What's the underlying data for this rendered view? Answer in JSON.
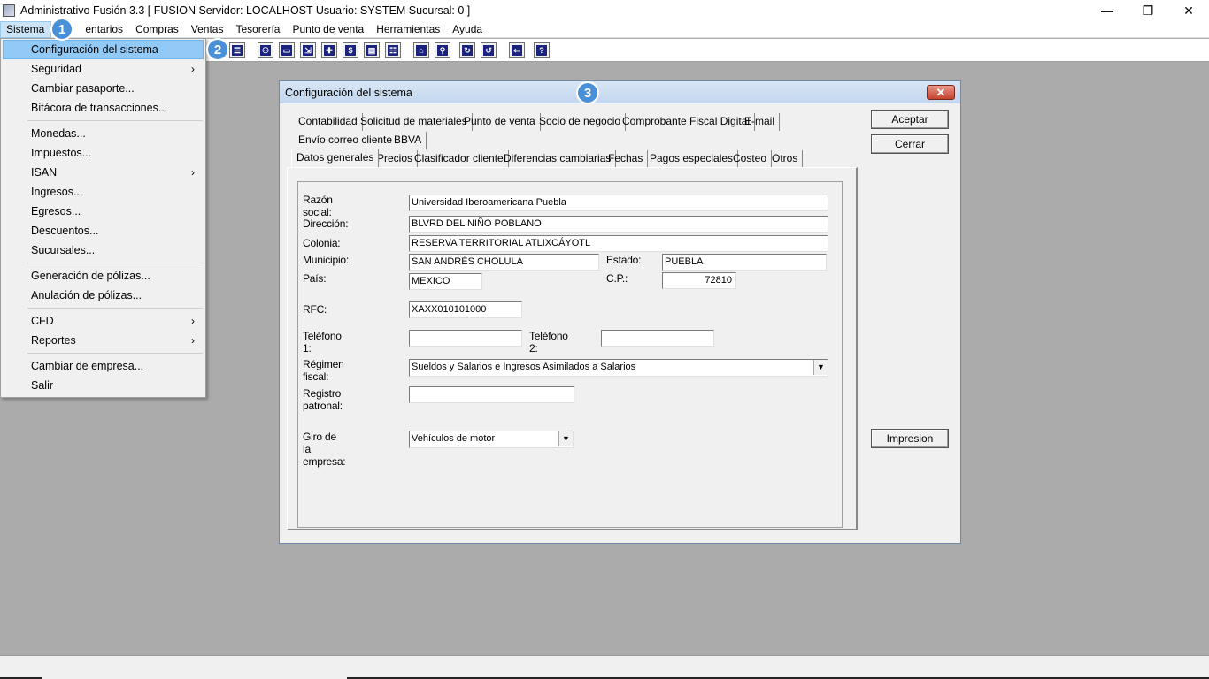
{
  "window": {
    "title": "Administrativo Fusión 3.3 [ FUSION   Servidor: LOCALHOST   Usuario: SYSTEM    Sucursal: 0 ]",
    "minimize": "—",
    "restore": "❐",
    "close": "✕"
  },
  "menubar": {
    "items": [
      "Sistema",
      "Inventarios",
      "Compras",
      "Ventas",
      "Tesorería",
      "Punto de venta",
      "Herramientas",
      "Ayuda"
    ],
    "visible_labels": [
      "Sistema",
      "entarios",
      "Compras",
      "Ventas",
      "Tesorería",
      "Punto de venta",
      "Herramientas",
      "Ayuda"
    ]
  },
  "badges": [
    "1",
    "2",
    "3"
  ],
  "toolbar": {
    "icons": [
      "config-icon",
      "binoculars-icon",
      "folder-icon",
      "export-icon",
      "add-icon",
      "dollar-icon",
      "document-icon",
      "list-icon",
      "home-icon",
      "zoom-icon",
      "refresh-icon",
      "undo-icon",
      "back-arrow-icon",
      "help-icon"
    ],
    "glyphs": [
      "☰",
      "⚇",
      "▭",
      "⇲",
      "✚",
      "$",
      "▤",
      "☷",
      "⌂",
      "⚲",
      "↻",
      "↺",
      "⇐",
      "?"
    ]
  },
  "sistema_menu": {
    "items": [
      {
        "label": "Configuración del sistema",
        "submenu": false
      },
      {
        "label": "Seguridad",
        "submenu": true
      },
      {
        "label": "Cambiar pasaporte...",
        "submenu": false
      },
      {
        "label": "Bitácora de transacciones...",
        "submenu": false
      },
      {
        "label": "Monedas...",
        "submenu": false
      },
      {
        "label": "Impuestos...",
        "submenu": false
      },
      {
        "label": "ISAN",
        "submenu": true
      },
      {
        "label": "Ingresos...",
        "submenu": false
      },
      {
        "label": "Egresos...",
        "submenu": false
      },
      {
        "label": "Descuentos...",
        "submenu": false
      },
      {
        "label": "Sucursales...",
        "submenu": false
      },
      {
        "label": "Generación de pólizas...",
        "submenu": false
      },
      {
        "label": "Anulación de pólizas...",
        "submenu": false
      },
      {
        "label": "CFD",
        "submenu": true
      },
      {
        "label": "Reportes",
        "submenu": true
      },
      {
        "label": "Cambiar de empresa...",
        "submenu": false
      },
      {
        "label": "Salir",
        "submenu": false
      }
    ],
    "arrow": "›"
  },
  "dialog": {
    "title": "Configuración del sistema",
    "close": "✕",
    "tabs_row1": [
      "Contabilidad",
      "Solicitud de materiales",
      "Punto de venta",
      "Socio de negocio",
      "Comprobante Fiscal Digital",
      "E-mail"
    ],
    "tabs_row2": [
      "Envío correo cliente",
      "BBVA"
    ],
    "tabs_row3": [
      "Datos generales",
      "Precios",
      "Clasificador cliente",
      "Diferencias cambiarias",
      "Fechas",
      "Pagos especiales",
      "Costeo",
      "Otros"
    ],
    "selected_tab": "Datos generales",
    "buttons": {
      "aceptar": "Aceptar",
      "cerrar": "Cerrar",
      "impresion": "Impresion"
    },
    "form": {
      "razon_social_label": "Razón social:",
      "razon_social": "Universidad Iberoamericana Puebla",
      "direccion_label": "Dirección:",
      "direccion": "BLVRD DEL NIÑO POBLANO",
      "colonia_label": "Colonia:",
      "colonia": "RESERVA TERRITORIAL ATLIXCÁYOTL",
      "municipio_label": "Municipio:",
      "municipio": "SAN ANDRÉS CHOLULA",
      "estado_label": "Estado:",
      "estado": "PUEBLA",
      "pais_label": "País:",
      "pais": "MEXICO",
      "cp_label": "C.P.:",
      "cp": "72810",
      "rfc_label": "RFC:",
      "rfc": "XAXX010101000",
      "telefono1_label": "Teléfono 1:",
      "telefono1": "",
      "telefono2_label": "Teléfono 2:",
      "telefono2": "",
      "regimen_label": "Régimen fiscal:",
      "regimen": "Sueldos y Salarios e Ingresos Asimilados a Salarios",
      "registro_label": "Registro patronal:",
      "registro": "",
      "giro_label": "Giro de la empresa:",
      "giro": "Vehículos de motor",
      "combo_arrow": "▼"
    }
  }
}
